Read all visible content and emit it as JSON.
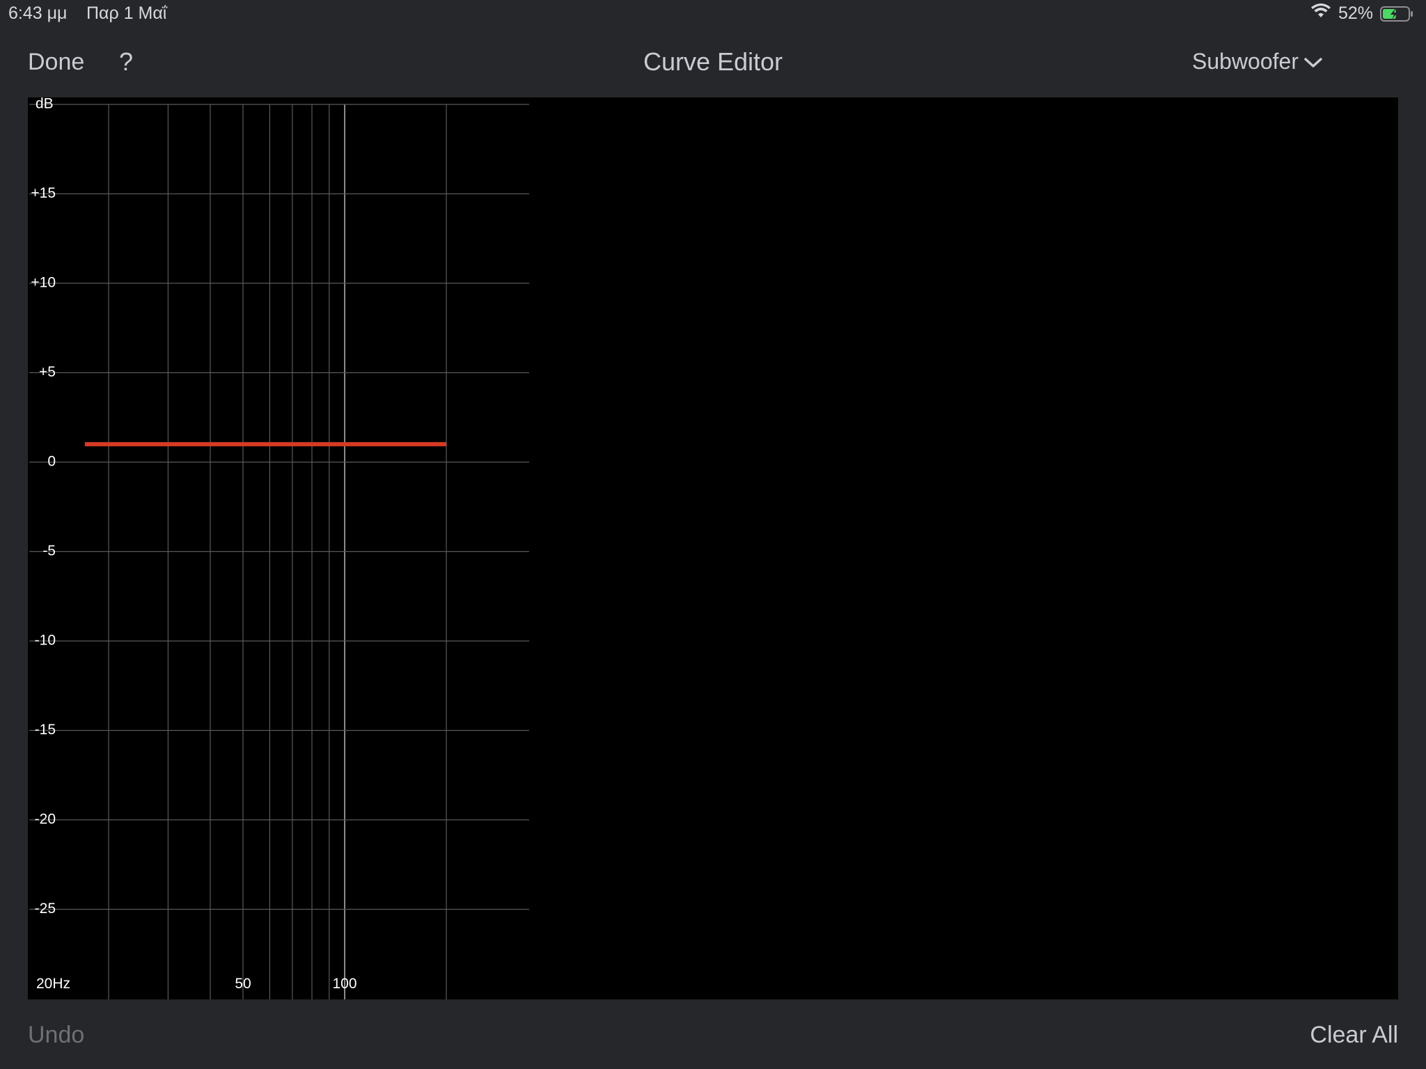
{
  "status_bar": {
    "time": "6:43 μμ",
    "date": "Παρ 1 Μαΐ",
    "battery_percent": "52%",
    "battery_level": 0.52,
    "battery_charging": true,
    "wifi_icon": "wifi-icon",
    "battery_icon": "battery-charging-icon"
  },
  "nav": {
    "done_label": "Done",
    "help_label": "?",
    "title": "Curve Editor",
    "speaker_label": "Subwoofer",
    "speaker_icon": "chevron-down-icon"
  },
  "bottom": {
    "undo_label": "Undo",
    "undo_enabled": false,
    "clear_all_label": "Clear All"
  },
  "colors": {
    "background": "#26272b",
    "chart_background": "#000000",
    "grid": "#5a5a5e",
    "curve": "#d83a22",
    "text": "#c9ccd2",
    "disabled_text": "#6f7074"
  },
  "chart_data": {
    "type": "line",
    "xscale": "log",
    "xlim": [
      17,
      200
    ],
    "ylim": [
      -30,
      20
    ],
    "grid": true,
    "y_unit_label": "dB",
    "y_ticks": [
      15,
      10,
      5,
      0,
      -5,
      -10,
      -15,
      -20,
      -25
    ],
    "y_tick_labels": [
      "+15",
      "+10",
      "+5",
      "0",
      "-5",
      "-10",
      "-15",
      "-20",
      "-25"
    ],
    "x_gridlines": [
      20,
      30,
      40,
      50,
      60,
      70,
      80,
      90,
      100,
      200
    ],
    "x_tick_labels": [
      {
        "x": 20,
        "label": "20Hz"
      },
      {
        "x": 50,
        "label": "50"
      },
      {
        "x": 100,
        "label": "100"
      }
    ],
    "series": [
      {
        "x": [
          17,
          200
        ],
        "y": [
          1,
          1
        ]
      }
    ]
  }
}
